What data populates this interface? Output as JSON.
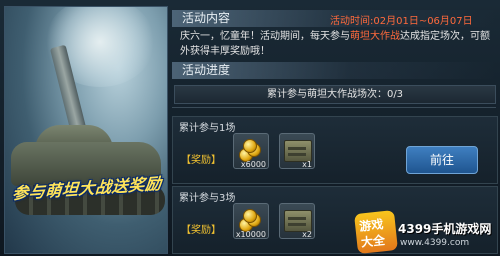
{
  "banner": {
    "title": "参与萌坦大战送奖励"
  },
  "activity": {
    "heading": "活动内容",
    "time": "活动时间:02月01日~06月07日",
    "desc_part1": "庆六一，忆童年！活动期间，每天参与",
    "desc_highlight": "萌坦大作战",
    "desc_part2": "达成指定场次，可额外获得丰厚奖励哦！"
  },
  "progress": {
    "heading": "活动进度",
    "text": "累计参与萌坦大作战场次：0/3"
  },
  "rewards": [
    {
      "title": "累计参与1场",
      "label": "【奖励】",
      "items": [
        {
          "icon": "gold-coins-icon",
          "qty": "x6000"
        },
        {
          "icon": "ammo-crate-icon",
          "qty": "x1"
        }
      ],
      "button": "前往"
    },
    {
      "title": "累计参与3场",
      "label": "【奖励】",
      "items": [
        {
          "icon": "gold-coins-icon",
          "qty": "x10000"
        },
        {
          "icon": "ammo-crate-icon",
          "qty": "x2"
        }
      ]
    }
  ],
  "watermark": {
    "logo_top": "游戏",
    "logo_bottom": "大全",
    "brand": "4399手机游戏网",
    "url": "www.4399.com"
  },
  "colors": {
    "accent_orange": "#ff6a3c",
    "reward_label": "#f2c230",
    "button_blue": "#2f6cab"
  }
}
